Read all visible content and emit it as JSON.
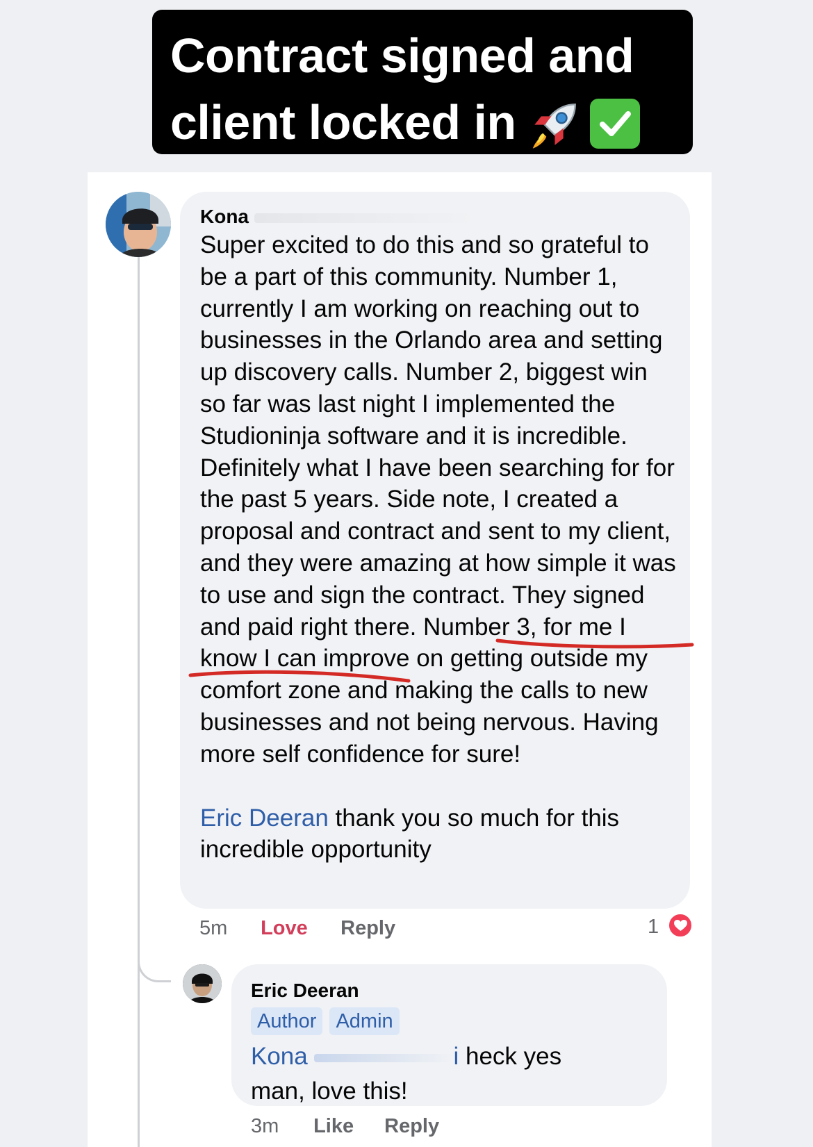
{
  "banner": {
    "line1": "Contract signed and",
    "line2": "client locked in",
    "emoji": [
      "rocket-icon",
      "check-mark-button-icon"
    ]
  },
  "post": {
    "author": "Kona",
    "text": "Super excited to do this and so grateful to be a part of this community. Number 1, currently I am working on reaching out to businesses in the Orlando area and setting up discovery calls. Number 2, biggest win so far was last night I implemented the Studioninja software and it is incredible. Definitely what I have been searching for for the past 5 years. Side note, I created a proposal and contract and sent to my client, and they were amazing at how simple it was to use and sign the contract. They signed and paid right there. Number 3, for me I know I can improve on getting outside my comfort zone and making the calls to new businesses and not being nervous. Having more self confidence for sure!",
    "mention": "Eric Deeran",
    "mention_text": " thank you so much for this incredible opportunity",
    "time": "5m",
    "love_label": "Love",
    "reply_label": "Reply",
    "reaction_count": "1",
    "highlight_color": "#d42a26"
  },
  "reply": {
    "author": "Eric Deeran",
    "badges": [
      "Author",
      "Admin"
    ],
    "mention": "Kona",
    "mention_tail": "i",
    "text_end": " heck yes",
    "text_line2": "man, love this!",
    "time": "3m",
    "like_label": "Like",
    "reply_label": "Reply"
  },
  "colors": {
    "mention": "#2f5ea8",
    "love": "#d23e5a",
    "bubble": "#f0f2f5",
    "badge_bg": "#dbe7f6"
  }
}
